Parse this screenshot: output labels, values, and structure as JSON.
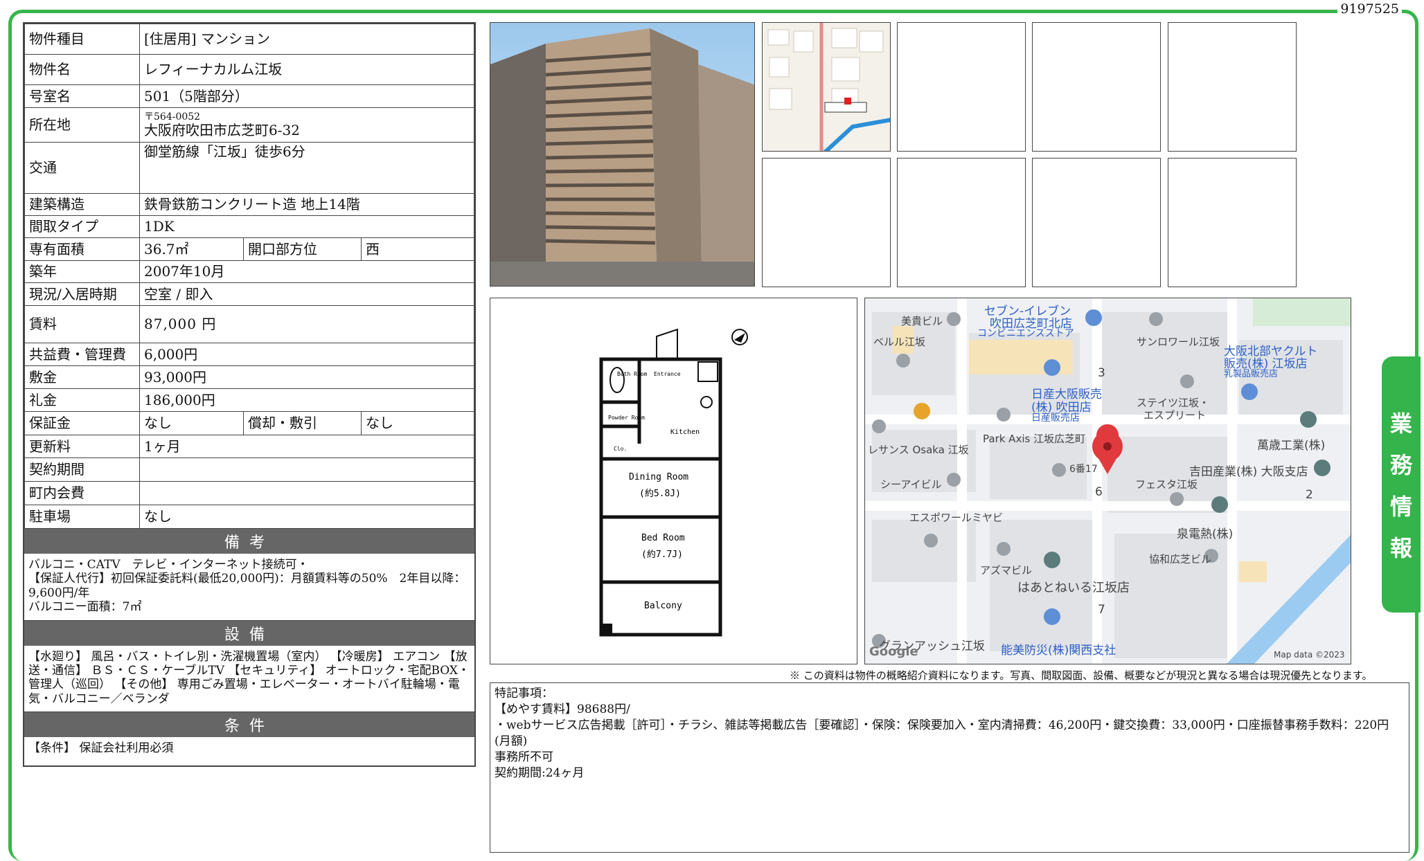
{
  "doc_number": "9197525",
  "side_tab": [
    "業",
    "務",
    "情",
    "報"
  ],
  "spec": {
    "type_label": "物件種目",
    "type_value": "[住居用] マンション",
    "name_label": "物件名",
    "name_value": "レフィーナカルム江坂",
    "room_label": "号室名",
    "room_value": "501（5階部分）",
    "address_label": "所在地",
    "postal": "〒564-0052",
    "address": "大阪府吹田市広芝町6-32",
    "transport_label": "交通",
    "transport_value": "御堂筋線「江坂」徒歩6分",
    "structure_label": "建築構造",
    "structure_value": "鉄骨鉄筋コンクリート造 地上14階",
    "layout_label": "間取タイプ",
    "layout_value": "1DK",
    "area_label": "専有面積",
    "area_value": "36.7㎡",
    "facing_label": "開口部方位",
    "facing_value": "西",
    "built_label": "築年",
    "built_value": "2007年10月",
    "status_label": "現況/入居時期",
    "status_value": "空室 / 即入",
    "rent_label": "賃料",
    "rent_value": "87,000 円",
    "mgmt_label": "共益費・管理費",
    "mgmt_value": "6,000円",
    "deposit_label": "敷金",
    "deposit_value": "93,000円",
    "keymoney_label": "礼金",
    "keymoney_value": "186,000円",
    "guarantee_label": "保証金",
    "guarantee_value": "なし",
    "amort_label": "償却・敷引",
    "amort_value": "なし",
    "renewal_label": "更新料",
    "renewal_value": "1ヶ月",
    "contract_label": "契約期間",
    "contract_value": "",
    "town_label": "町内会費",
    "town_value": "",
    "parking_label": "駐車場",
    "parking_value": "なし"
  },
  "remarks": {
    "title": "備考",
    "line1": "バルコニ・CATV　テレビ・インターネット接続可・",
    "line2": "【保証人代行】初回保証委託料(最低20,000円)：月額賃料等の50%　2年目以降：9,600円/年",
    "line3": "バルコニー面積：7㎡"
  },
  "facilities": {
    "title": "設備",
    "text": "【水廻り】 風呂・バス・トイレ別・洗濯機置場（室内） 【冷暖房】 エアコン 【放送・通信】 ＢＳ・ＣＳ・ケーブルTV 【セキュリティ】 オートロック・宅配BOX・管理人（巡回） 【その他】 専用ごみ置場・エレベーター・オートバイ駐輪場・電気・バルコニー／ベランダ"
  },
  "conditions": {
    "title": "条件",
    "text": "【条件】 保証会社利用必須"
  },
  "floorplan": {
    "bath": "Bath Room",
    "entrance": "Entrance",
    "powder": "Powder Room",
    "kitchen": "Kitchen",
    "closet": "Clo.",
    "dining": "Dining Room",
    "dining_size": "(約5.8J)",
    "bed": "Bed Room",
    "bed_size": "(約7.7J)",
    "balcony": "Balcony"
  },
  "map": {
    "labels": [
      "美貴ビル",
      "セブン-イレブン",
      "吹田広芝町北店",
      "コンビニエンスストア",
      "ベルル江坂",
      "サンロワール江坂",
      "大阪北部ヤクルト",
      "販売(株) 江坂店",
      "乳製品販売店",
      "3",
      "日産大阪販売",
      "(株) 吹田店",
      "日産販売店",
      "ステイツ江坂・",
      "エスプリート",
      "萬歳工業(株)",
      "レサンス Osaka 江坂",
      "Park Axis 江坂広芝町",
      "6番17",
      "吉田産業(株) 大阪支店",
      "シーアイビル",
      "6",
      "フェスタ江坂",
      "2",
      "エスポワールミヤビ",
      "泉電熱(株)",
      "協和広芝ビル",
      "アズマビル",
      "はあとねいる江坂店",
      "7",
      "グランアッシュ江坂",
      "能美防災(株)関西支社",
      "Google",
      "Map data ©2023"
    ]
  },
  "disclaimer": "※ この資料は物件の概略紹介資料になります。写真、間取図面、設備、概要などが現況と異なる場合は現況優先となります。",
  "special": {
    "title": "特記事項：",
    "line1": "【めやす賃料】98688円/",
    "line2": "・webサービス広告掲載［許可］・チラシ、雑誌等掲載広告［要確認］・保険：保険要加入・室内清掃費：46,200円・鍵交換費：33,000円・口座振替事務手数料：220円(月額)",
    "line3": "事務所不可",
    "line4": "契約期間:24ヶ月"
  },
  "colors": {
    "frame": "#35b54a",
    "section_header": "#666666",
    "map_pin": "#e03a3e"
  }
}
